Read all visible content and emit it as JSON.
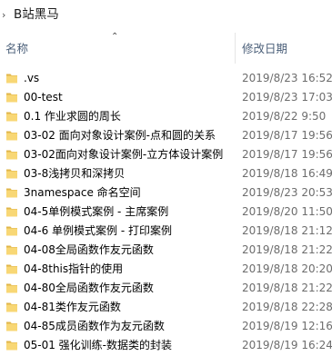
{
  "window": {
    "path_title": "B站黑马"
  },
  "header": {
    "name_label": "名称",
    "date_label": "修改日期"
  },
  "colors": {
    "folder_yellow": "#f8d775",
    "folder_shadow": "#e0b64a",
    "header_text": "#4c607a",
    "date_text": "#6d6d6d"
  },
  "files": [
    {
      "name": ".vs",
      "date": "2019/8/23 16:52",
      "icon": "folder-icon"
    },
    {
      "name": "00-test",
      "date": "2019/8/23 17:03",
      "icon": "folder-icon"
    },
    {
      "name": "0.1 作业求圆的周长",
      "date": "2019/8/22 9:50",
      "icon": "folder-icon"
    },
    {
      "name": "03-02 面向对象设计案例-点和圆的关系",
      "date": "2019/8/17 19:56",
      "icon": "folder-icon"
    },
    {
      "name": "03-02面向对象设计案例-立方体设计案例",
      "date": "2019/8/17 19:56",
      "icon": "folder-icon"
    },
    {
      "name": "03-8浅拷贝和深拷贝",
      "date": "2019/8/18 16:49",
      "icon": "folder-icon"
    },
    {
      "name": "3namespace 命名空间",
      "date": "2019/8/23 20:53",
      "icon": "folder-icon"
    },
    {
      "name": "04-5单例模式案例 - 主席案例",
      "date": "2019/8/20 11:50",
      "icon": "folder-icon"
    },
    {
      "name": "04-6 单例模式案例 - 打印案例",
      "date": "2019/8/18 21:12",
      "icon": "folder-icon"
    },
    {
      "name": "04-08全局函数作友元函数",
      "date": "2019/8/18 21:22",
      "icon": "folder-icon"
    },
    {
      "name": "04-8this指针的使用",
      "date": "2019/8/18 20:20",
      "icon": "folder-icon"
    },
    {
      "name": "04-80全局函数作友元函数",
      "date": "2019/8/18 21:22",
      "icon": "folder-icon"
    },
    {
      "name": "04-81类作友元函数",
      "date": "2019/8/18 22:28",
      "icon": "folder-icon"
    },
    {
      "name": "04-85成员函数作为友元函数",
      "date": "2019/8/19 12:16",
      "icon": "folder-icon"
    },
    {
      "name": "05-01 强化训练-数据类的封装",
      "date": "2019/8/19 16:24",
      "icon": "folder-icon"
    }
  ]
}
